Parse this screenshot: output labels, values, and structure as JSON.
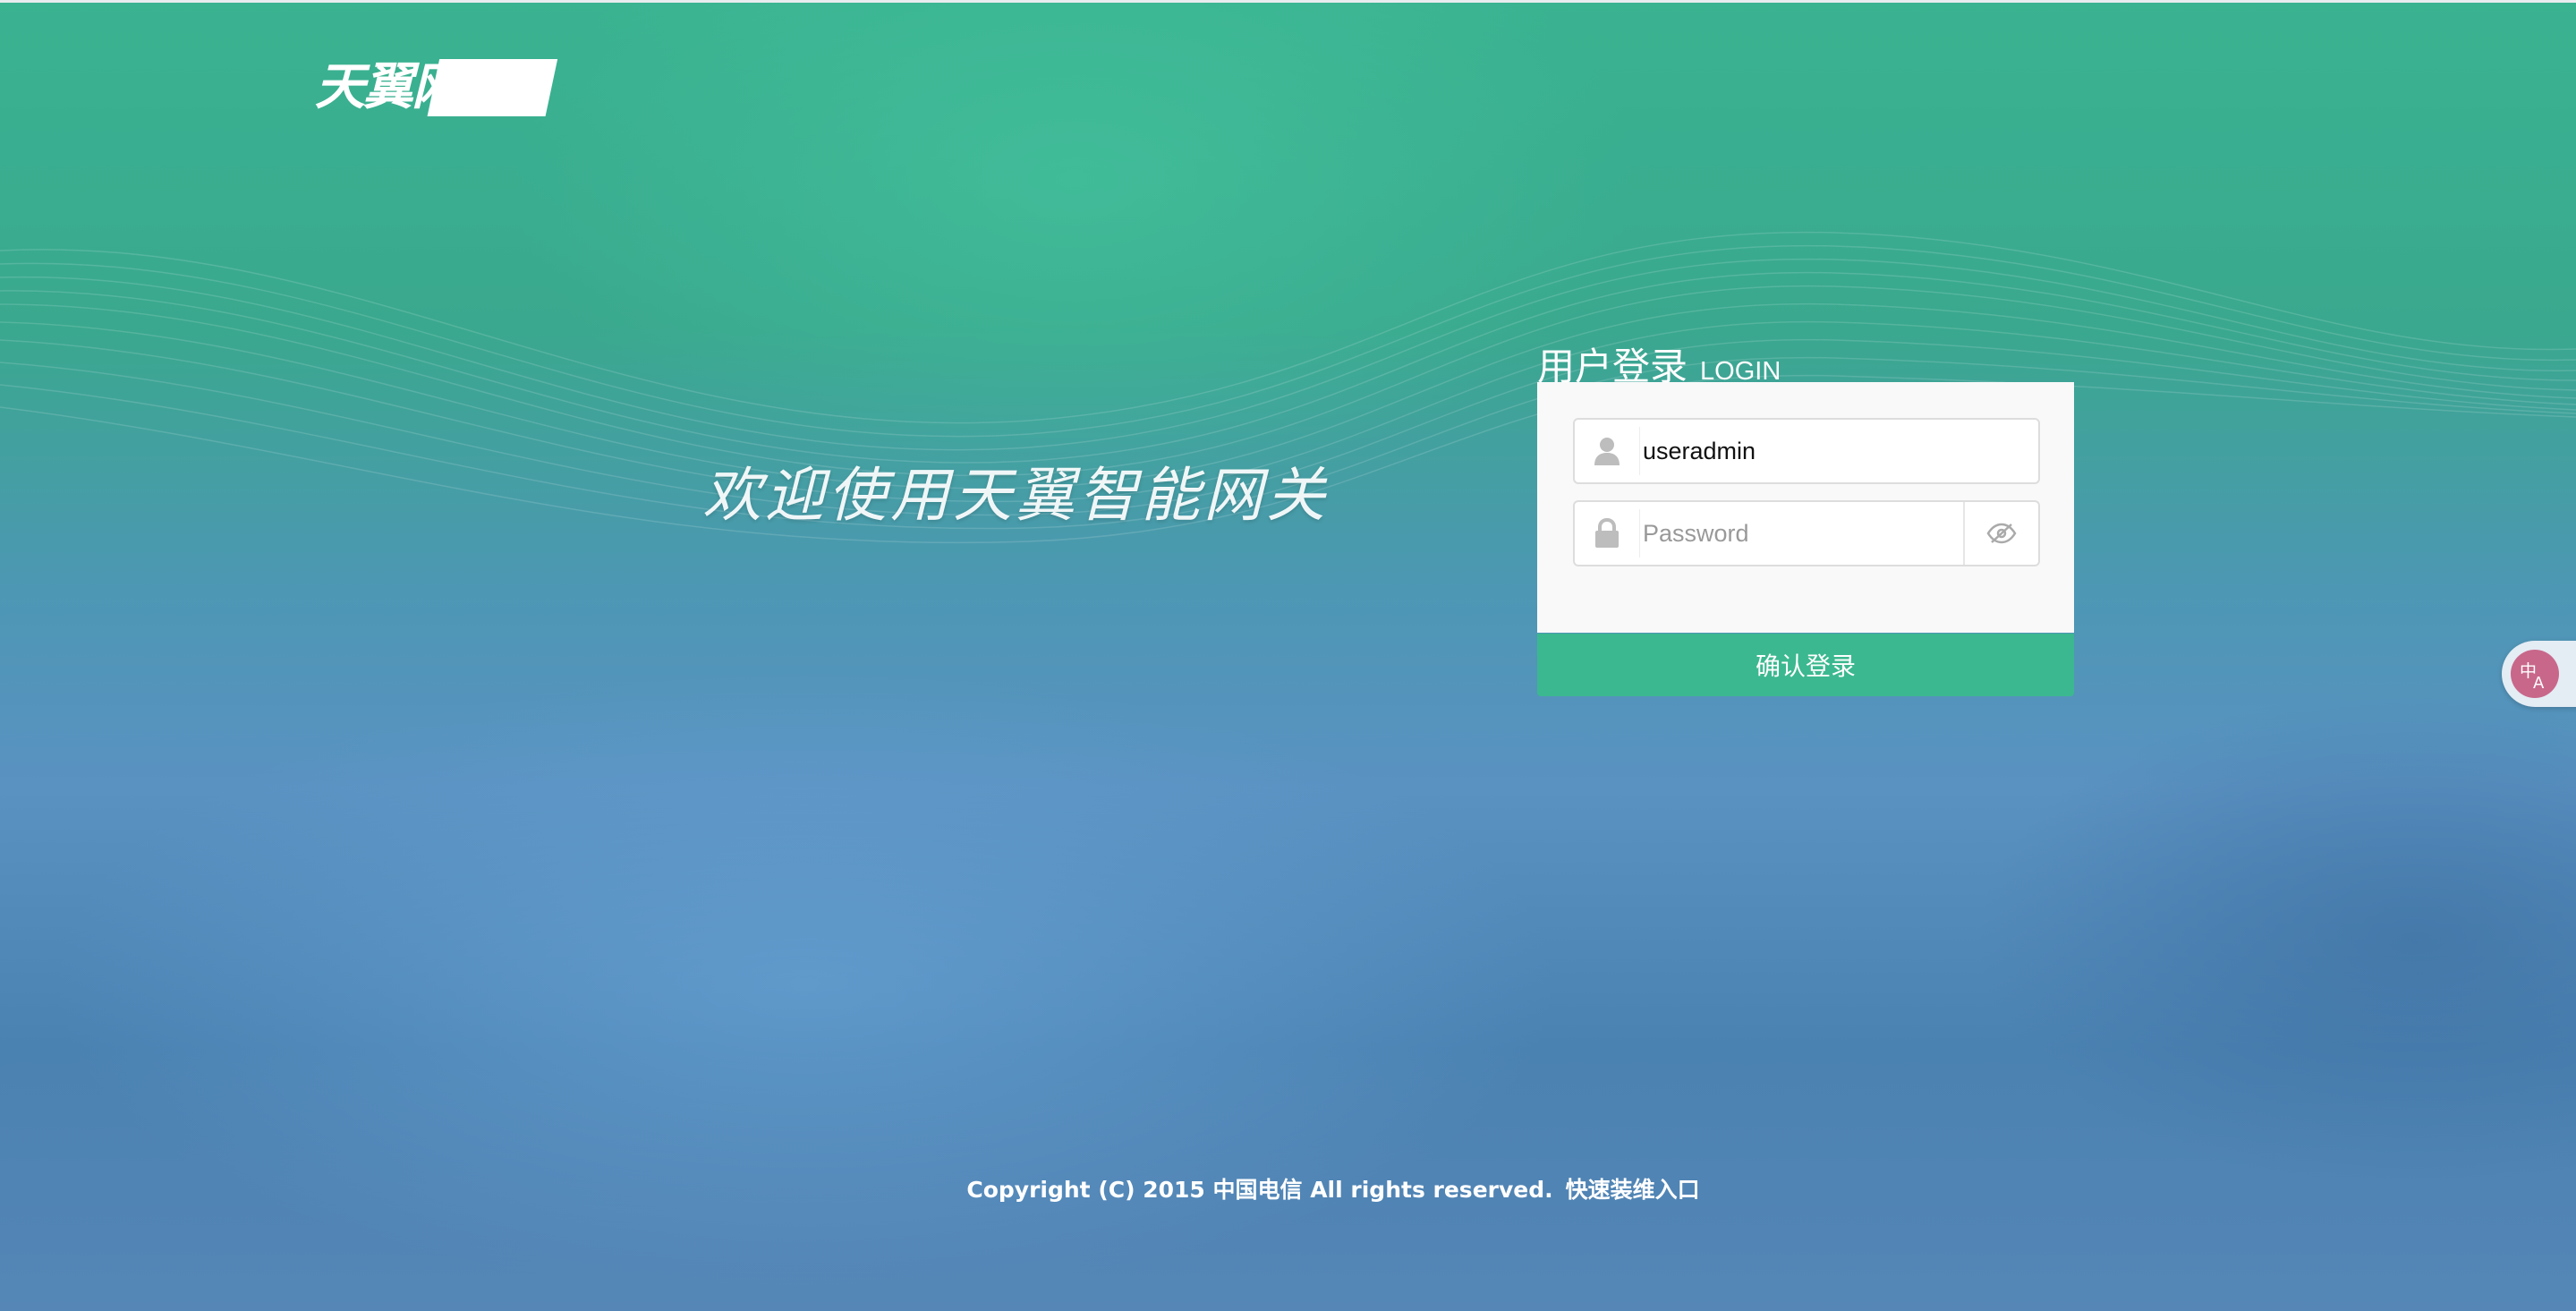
{
  "header": {
    "logo_text": "天翼网关"
  },
  "hero": {
    "welcome_text": "欢迎使用天翼智能网关"
  },
  "login": {
    "title_cn": "用户登录",
    "title_en": "LOGIN",
    "username_value": "useradmin",
    "password_value": "",
    "password_placeholder": "Password",
    "submit_label": "确认登录"
  },
  "footer": {
    "copyright": "Copyright (C) 2015 中国电信 All rights reserved.",
    "quick_link": "快速装维入口"
  },
  "translate_widget": {
    "icon": "translate-icon"
  },
  "colors": {
    "accent": "#3bb88f",
    "translate_badge": "#c8678a"
  }
}
